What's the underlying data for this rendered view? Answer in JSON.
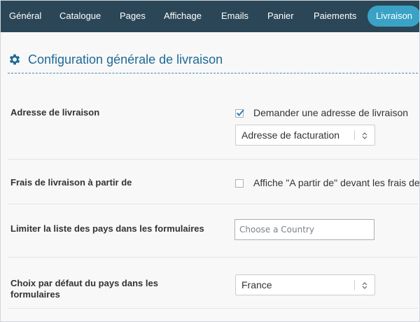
{
  "nav": {
    "tabs": [
      {
        "label": "Général"
      },
      {
        "label": "Catalogue"
      },
      {
        "label": "Pages"
      },
      {
        "label": "Affichage"
      },
      {
        "label": "Emails"
      },
      {
        "label": "Panier"
      },
      {
        "label": "Paiements"
      },
      {
        "label": "Livraison",
        "active": true
      }
    ],
    "colors": {
      "bar": "#2b4757",
      "active": "#3aa3c5"
    }
  },
  "section": {
    "icon": "gear-icon",
    "title": "Configuration générale de livraison"
  },
  "rows": {
    "address": {
      "label": "Adresse de livraison",
      "checkbox_label": "Demander une adresse de livraison",
      "checkbox_checked": true,
      "select_value": "Adresse de facturation"
    },
    "shipping_fees": {
      "label": "Frais de livraison à partir de",
      "checkbox_label": "Affiche \"A partir de\" devant les frais de",
      "checkbox_checked": false
    },
    "country_limit": {
      "label": "Limiter la liste des pays dans les formulaires",
      "placeholder": "Choose a Country"
    },
    "default_country": {
      "label": "Choix par défaut du pays dans les formulaires",
      "select_value": "France"
    }
  }
}
